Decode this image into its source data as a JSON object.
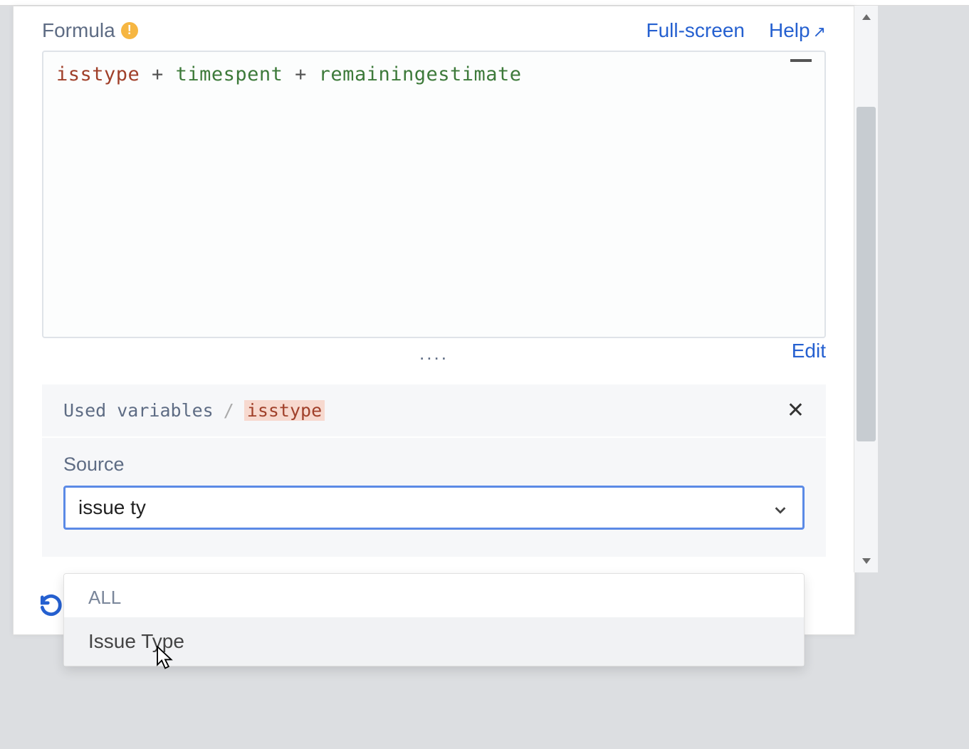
{
  "header": {
    "formula_label": "Formula",
    "fullscreen_label": "Full-screen",
    "help_label": "Help"
  },
  "formula": {
    "token1": "isstype",
    "op1": " + ",
    "token2": "timespent",
    "op2": " + ",
    "token3": "remainingestimate"
  },
  "dots": "....",
  "edit_label": "Edit",
  "breadcrumb": {
    "used_variables": "Used variables",
    "sep": "/",
    "current": "isstype"
  },
  "source": {
    "label": "Source",
    "input_value": "issue ty"
  },
  "dropdown": {
    "group": "ALL",
    "items": [
      "Issue Type"
    ]
  }
}
